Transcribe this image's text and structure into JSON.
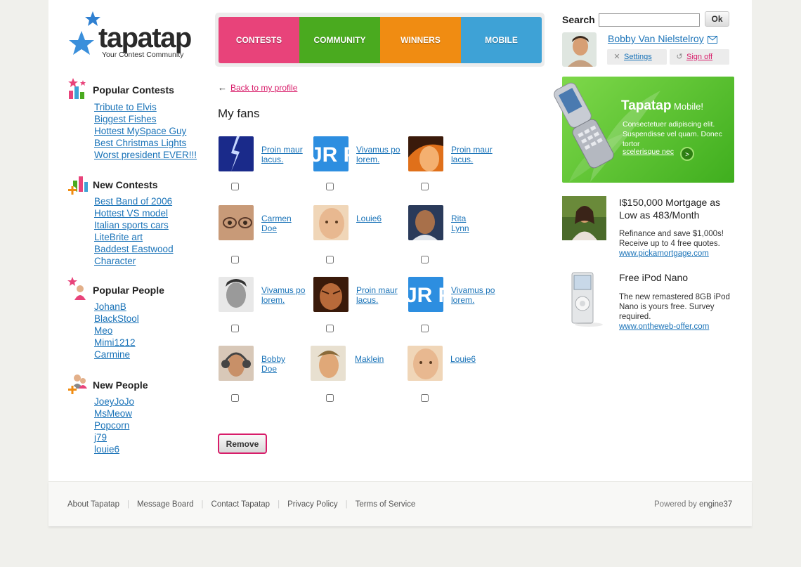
{
  "logo": {
    "word": "tapatap",
    "tagline": "Your Contest Community"
  },
  "nav": [
    {
      "label": "CONTESTS",
      "color": "#e8437a"
    },
    {
      "label": "COMMUNITY",
      "color": "#4aaa1f"
    },
    {
      "label": "WINNERS",
      "color": "#f08c12"
    },
    {
      "label": "MOBILE",
      "color": "#3ea2d6"
    }
  ],
  "search": {
    "label": "Search",
    "value": "",
    "ok_label": "Ok"
  },
  "user": {
    "name": "Bobby Van Nielstelroy",
    "settings": "Settings",
    "signoff": "Sign off"
  },
  "sidebar": {
    "popular_contests": {
      "title": "Popular Contests",
      "items": [
        "Tribute to Elvis",
        "Biggest Fishes",
        "Hottest MySpace Guy",
        "Best Christmas Lights",
        "Worst president EVER!!!"
      ]
    },
    "new_contests": {
      "title": "New Contests",
      "items": [
        "Best Band of 2006",
        "Hottest VS model",
        "Italian sports cars",
        "LiteBrite art",
        "Baddest Eastwood",
        "Character"
      ]
    },
    "popular_people": {
      "title": "Popular People",
      "items": [
        "JohanB",
        "BlackStool",
        "Meo",
        "Mimi1212",
        "Carmine"
      ]
    },
    "new_people": {
      "title": "New People",
      "items": [
        "JoeyJoJo",
        "MsMeow",
        "Popcorn",
        "j79",
        "louie6"
      ]
    }
  },
  "content": {
    "back_link": "Back to my profile",
    "back_arrow": "←",
    "title": "My fans",
    "fans": [
      {
        "line1": "Proin maur",
        "line2": "lacus."
      },
      {
        "line1": "Vivamus po",
        "line2": "lorem."
      },
      {
        "line1": "Proin maur",
        "line2": "lacus."
      },
      {
        "line1": "Carmen",
        "line2": "Doe"
      },
      {
        "line1": "Louie6",
        "line2": ""
      },
      {
        "line1": "Rita",
        "line2": "Lynn"
      },
      {
        "line1": "Vivamus po",
        "line2": "lorem."
      },
      {
        "line1": "Proin maur",
        "line2": "lacus."
      },
      {
        "line1": "Vivamus po",
        "line2": "lorem."
      },
      {
        "line1": "Bobby",
        "line2": "Doe"
      },
      {
        "line1": "Maklein",
        "line2": ""
      },
      {
        "line1": "Louie6",
        "line2": ""
      }
    ],
    "remove_label": "Remove"
  },
  "promo": {
    "brand": "Tapatap",
    "suffix": " Mobile!",
    "text": "Consectetuer adipiscing elit. Suspendisse vel quam. Donec tortor",
    "link": "scelerisque nec",
    "go": ">"
  },
  "ads": [
    {
      "title": "I$150,000 Mortgage as Low as 483/Month",
      "text": "Refinance and save $1,000s! Receive up to 4 free quotes.",
      "link": "www.pickamortgage.com"
    },
    {
      "title": "Free iPod Nano",
      "text": "The new remastered 8GB iPod Nano is yours free. Survey required.",
      "link": "www.ontheweb-offer.com"
    }
  ],
  "footer": {
    "links": [
      "About Tapatap",
      "Message Board",
      "Contact Tapatap",
      "Privacy Policy",
      "Terms of Service"
    ],
    "powered_prefix": "Powered by",
    "powered_brand": "engine37"
  }
}
